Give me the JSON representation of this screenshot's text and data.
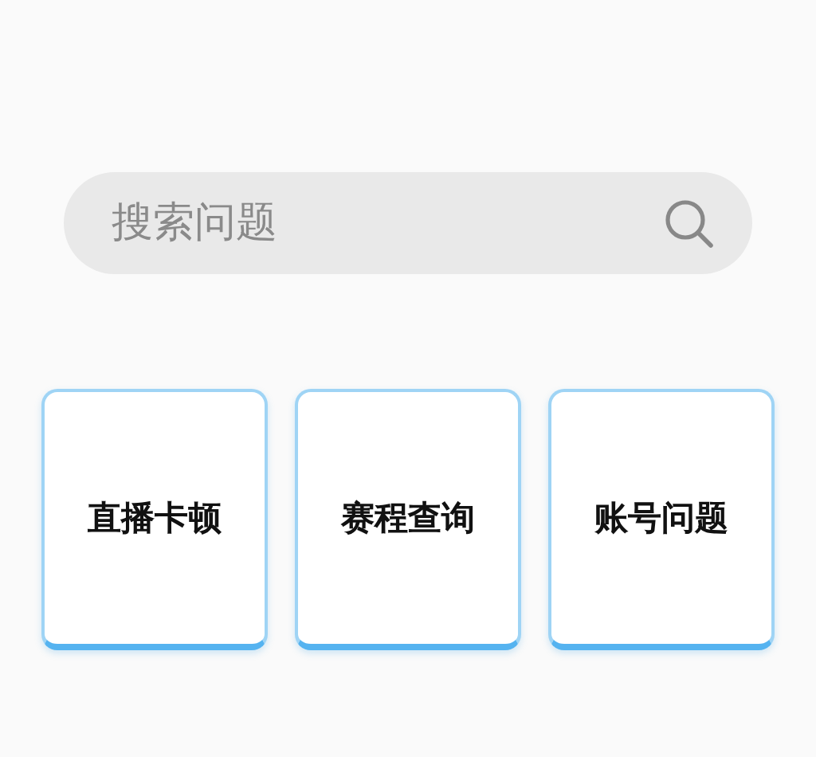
{
  "search": {
    "placeholder": "搜索问题"
  },
  "categories": [
    {
      "label": "直播卡顿"
    },
    {
      "label": "赛程查询"
    },
    {
      "label": "账号问题"
    }
  ]
}
